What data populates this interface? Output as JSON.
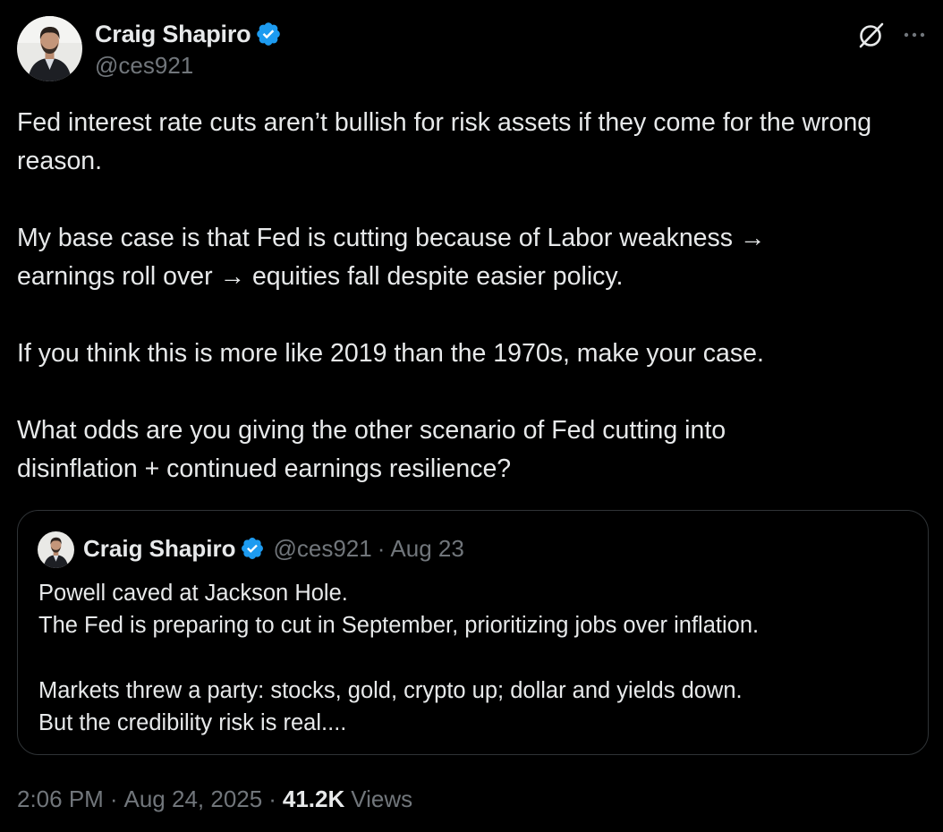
{
  "colors": {
    "background": "#000000",
    "text_primary": "#e7e9ea",
    "text_secondary": "#71767b",
    "verified_badge": "#1d9bf0",
    "border": "#2f3336"
  },
  "author": {
    "display_name": "Craig Shapiro",
    "handle": "@ces921",
    "verified": true,
    "avatar_icon": "profile-photo"
  },
  "header_actions": {
    "grok_icon": "grok-icon",
    "more_icon": "more-icon"
  },
  "tweet": {
    "paragraphs": [
      "Fed interest rate cuts aren’t bullish for risk assets if they come for the wrong reason.",
      "My base case is that Fed is cutting because of Labor weakness →\nearnings roll over → equities fall despite easier policy.",
      "If you think this is more like 2019 than the 1970s, make your case.",
      "What odds are you giving the other scenario of Fed cutting into\ndisinflation + continued earnings resilience?"
    ]
  },
  "quoted_tweet": {
    "display_name": "Craig Shapiro",
    "handle": "@ces921",
    "separator": "·",
    "date": "Aug 23",
    "lines_1": [
      "Powell caved at Jackson Hole.",
      "The Fed is preparing to cut in September, prioritizing jobs over inflation."
    ],
    "lines_2": [
      "Markets threw a party: stocks, gold, crypto up; dollar and yields down.",
      "But the credibility risk is real...."
    ]
  },
  "meta": {
    "time": "2:06 PM",
    "separator": "·",
    "date": "Aug 24, 2025",
    "views_count": "41.2K",
    "views_label": "Views"
  }
}
